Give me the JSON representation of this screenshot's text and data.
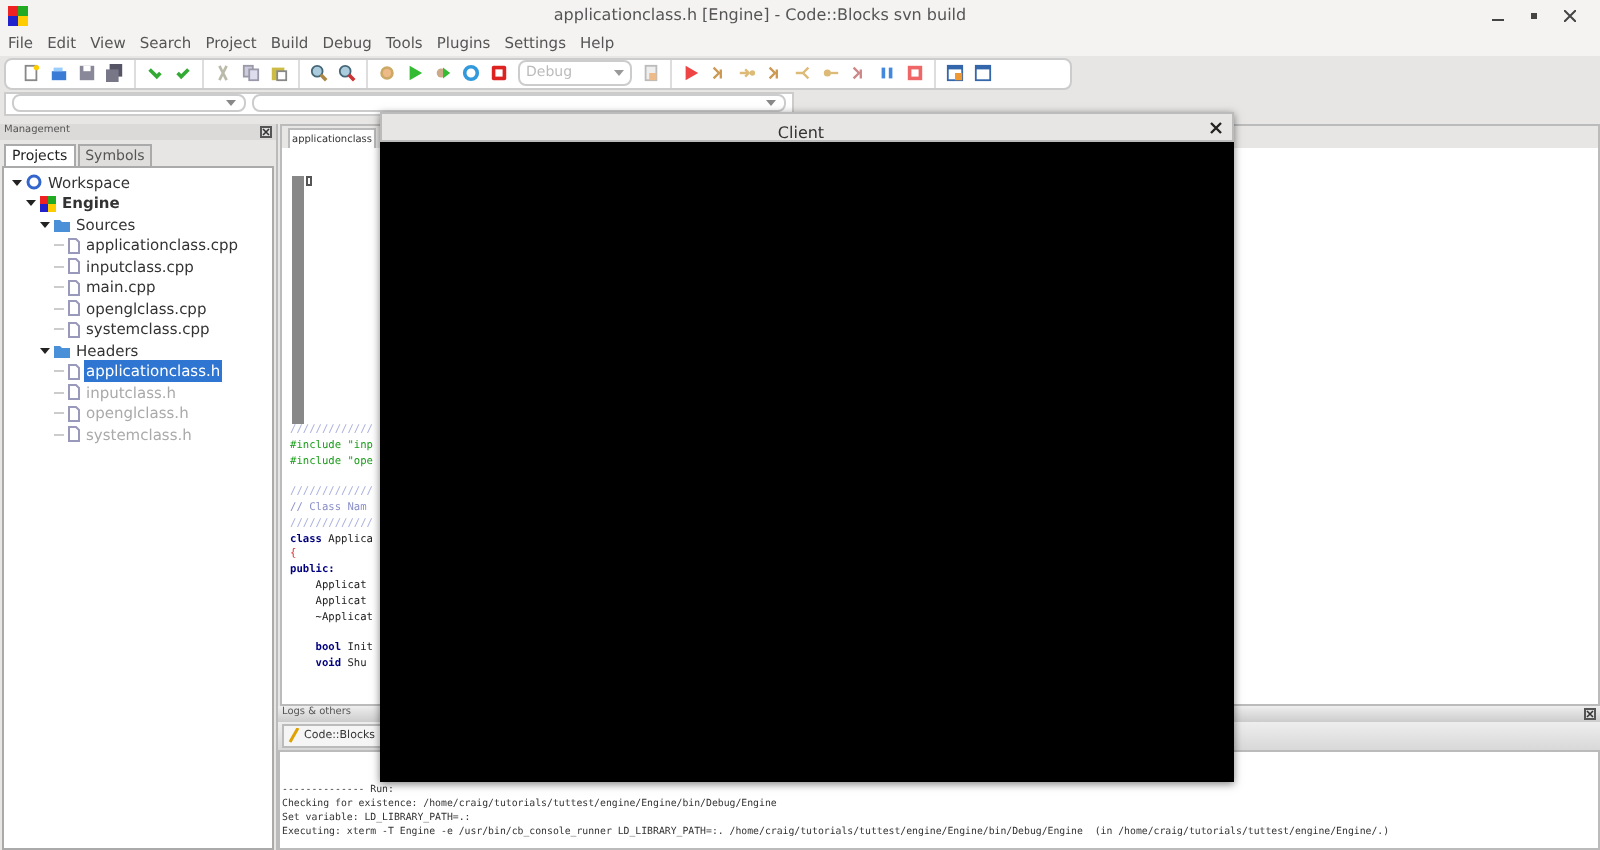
{
  "window": {
    "title": "applicationclass.h [Engine] - Code::Blocks svn build"
  },
  "menu": [
    "File",
    "Edit",
    "View",
    "Search",
    "Project",
    "Build",
    "Debug",
    "Tools",
    "Plugins",
    "Settings",
    "Help"
  ],
  "toolbar": {
    "build_target": {
      "value": "Debug",
      "disabled": true
    }
  },
  "management": {
    "title": "Management",
    "tabs": [
      {
        "label": "Projects",
        "selected": true
      },
      {
        "label": "Symbols",
        "selected": false
      }
    ],
    "tree": [
      {
        "label": "Workspace",
        "kind": "workspace",
        "expanded": true,
        "children": [
          {
            "label": "Engine",
            "kind": "project",
            "expanded": true,
            "children": [
              {
                "label": "Sources",
                "kind": "folder",
                "expanded": true,
                "children": [
                  {
                    "label": "applicationclass.cpp",
                    "kind": "file",
                    "selected": false,
                    "disabled": false
                  },
                  {
                    "label": "inputclass.cpp",
                    "kind": "file",
                    "selected": false,
                    "disabled": false
                  },
                  {
                    "label": "main.cpp",
                    "kind": "file",
                    "selected": false,
                    "disabled": false
                  },
                  {
                    "label": "openglclass.cpp",
                    "kind": "file",
                    "selected": false,
                    "disabled": false
                  },
                  {
                    "label": "systemclass.cpp",
                    "kind": "file",
                    "selected": false,
                    "disabled": false
                  }
                ]
              },
              {
                "label": "Headers",
                "kind": "folder",
                "expanded": true,
                "children": [
                  {
                    "label": "applicationclass.h",
                    "kind": "file",
                    "selected": true,
                    "disabled": false
                  },
                  {
                    "label": "inputclass.h",
                    "kind": "file",
                    "selected": false,
                    "disabled": true
                  },
                  {
                    "label": "openglclass.h",
                    "kind": "file",
                    "selected": false,
                    "disabled": true
                  },
                  {
                    "label": "systemclass.h",
                    "kind": "file",
                    "selected": false,
                    "disabled": true
                  }
                ]
              }
            ]
          }
        ]
      }
    ]
  },
  "editor": {
    "tab": "applicationclass",
    "code": [
      {
        "text": "/////////////",
        "kind": "doc"
      },
      {
        "text": "#include \"inp",
        "kind": "pre"
      },
      {
        "text": "#include \"ope",
        "kind": "pre"
      },
      {
        "kind": "blank"
      },
      {
        "text": "/////////////",
        "kind": "doc"
      },
      {
        "text": "// Class Nam",
        "kind": "comment"
      },
      {
        "text": "/////////////",
        "kind": "doc"
      },
      {
        "text": "**class** Applica",
        "kind": "plain"
      },
      {
        "text": "{",
        "kind": "brace"
      },
      {
        "text": "public:",
        "kind": "keyword"
      },
      {
        "text": "    Applicat",
        "kind": "plain"
      },
      {
        "text": "    Applicat",
        "kind": "plain"
      },
      {
        "text": "    ~Applicat",
        "kind": "plain"
      },
      {
        "kind": "blank"
      },
      {
        "text": "    **bool** Init",
        "kind": "plain"
      },
      {
        "text": "    **void** Shu",
        "kind": "plain"
      }
    ]
  },
  "logs": {
    "title": "Logs & others",
    "tab": "Code::Blocks",
    "lines": [
      "-------------- Run:",
      "Checking for existence: /home/craig/tutorials/tuttest/engine/Engine/bin/Debug/Engine",
      "Set variable: LD_LIBRARY_PATH=.:",
      "Executing: xterm -T Engine -e /usr/bin/cb_console_runner LD_LIBRARY_PATH=:. /home/craig/tutorials/tuttest/engine/Engine/bin/Debug/Engine  (in /home/craig/tutorials/tuttest/engine/Engine/.)"
    ]
  },
  "client_window": {
    "title": "Client"
  }
}
